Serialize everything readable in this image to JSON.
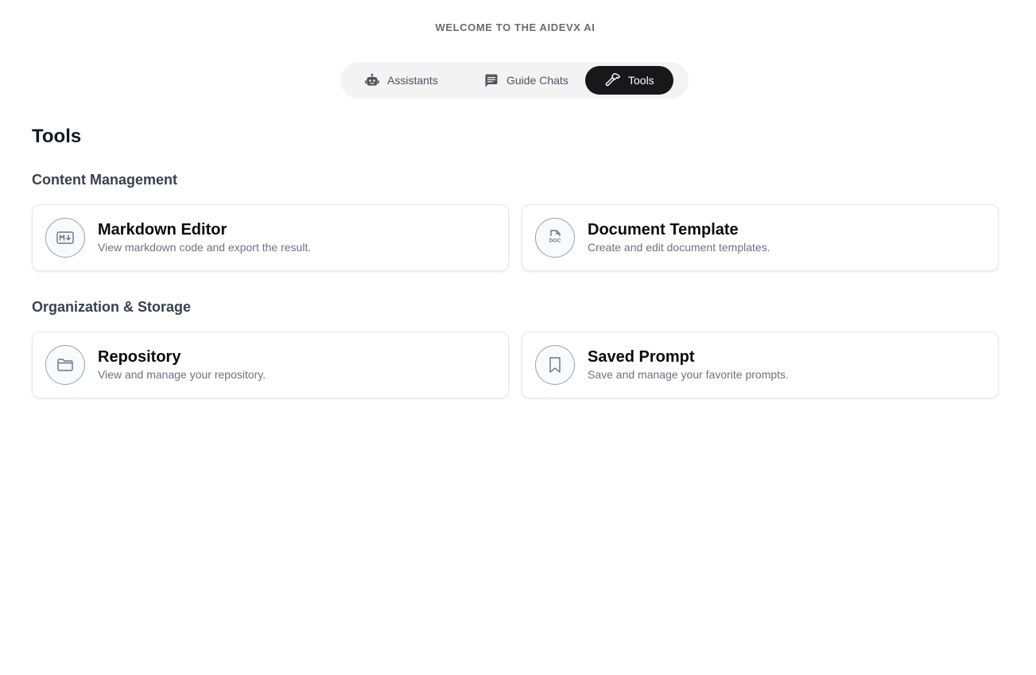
{
  "header": {
    "welcome": "WELCOME TO THE AIDEVX AI"
  },
  "tabs": [
    {
      "label": "Assistants",
      "icon": "robot-icon",
      "active": false
    },
    {
      "label": "Guide Chats",
      "icon": "message-icon",
      "active": false
    },
    {
      "label": "Tools",
      "icon": "hammer-icon",
      "active": true
    }
  ],
  "main": {
    "title": "Tools",
    "sections": [
      {
        "title": "Content Management",
        "cards": [
          {
            "name": "Markdown Editor",
            "description": "View markdown code and export the result.",
            "icon": "markdown-icon"
          },
          {
            "name": "Document Template",
            "description": "Create and edit document templates.",
            "icon": "doc-file-icon",
            "icon_text": "DOC"
          }
        ]
      },
      {
        "title": "Organization & Storage",
        "cards": [
          {
            "name": "Repository",
            "description": "View and manage your repository.",
            "icon": "folder-icon"
          },
          {
            "name": "Saved Prompt",
            "description": "Save and manage your favorite prompts.",
            "icon": "bookmark-icon"
          }
        ]
      }
    ]
  },
  "colors": {
    "active_tab_bg": "#18181b",
    "tab_bar_bg": "#f3f3f3",
    "icon_stroke": "#64748b"
  }
}
